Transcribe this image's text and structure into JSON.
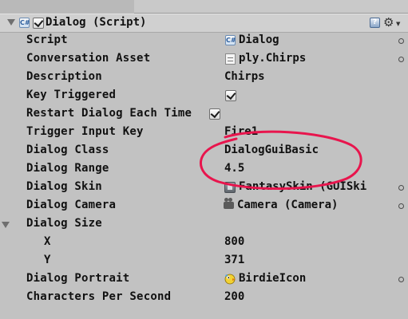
{
  "component": {
    "title": "Dialog (Script)",
    "enabled": true
  },
  "fields": {
    "script": {
      "label": "Script",
      "value": "Dialog"
    },
    "conversation_asset": {
      "label": "Conversation Asset",
      "value": "ply.Chirps"
    },
    "description": {
      "label": "Description",
      "value": "Chirps"
    },
    "key_triggered": {
      "label": "Key Triggered",
      "checked": true
    },
    "restart_dialog": {
      "label": "Restart Dialog Each Time",
      "checked": true
    },
    "trigger_input_key": {
      "label": "Trigger Input Key",
      "value": "Fire1"
    },
    "dialog_class": {
      "label": "Dialog Class",
      "value": "DialogGuiBasic"
    },
    "dialog_range": {
      "label": "Dialog Range",
      "value": "4.5"
    },
    "dialog_skin": {
      "label": "Dialog Skin",
      "value": "FantasySkin (GUISki"
    },
    "dialog_camera": {
      "label": "Dialog Camera",
      "value": "Camera (Camera)"
    },
    "dialog_size": {
      "label": "Dialog Size",
      "x_label": "X",
      "x_value": "800",
      "y_label": "Y",
      "y_value": "371"
    },
    "dialog_portrait": {
      "label": "Dialog Portrait",
      "value": "BirdieIcon"
    },
    "chars_per_second": {
      "label": "Characters Per Second",
      "value": "200"
    }
  },
  "icons": {
    "script_badge": "C#",
    "help": "?",
    "gear": "⚙",
    "gear_caret": "▼"
  },
  "colors": {
    "panel_bg": "#c2c2c2",
    "annotation": "#e8154d"
  }
}
